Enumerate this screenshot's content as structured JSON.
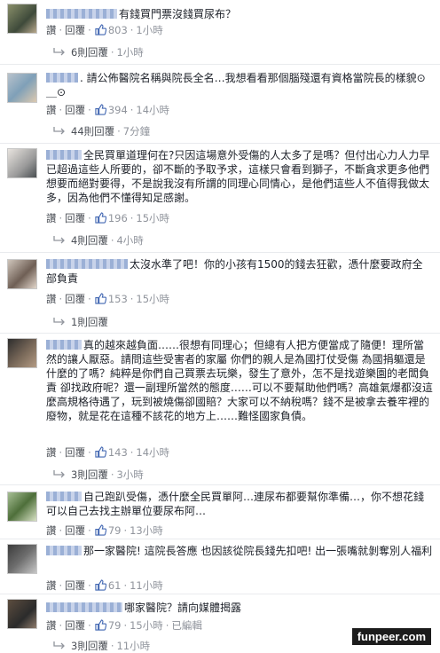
{
  "ui": {
    "like": "讚",
    "reply": "回覆",
    "dot": "·",
    "edited": "已編輯"
  },
  "comments": [
    {
      "text": "有錢買門票沒錢買尿布？",
      "likes": "803",
      "time": "1小時",
      "replies": "6則回覆",
      "replies_time": "1小時"
    },
    {
      "text": ". 請公佈醫院名稱與院長全名…我想看看那個腦殘還有資格當院長的樣貌⊙＿⊙",
      "likes": "394",
      "time": "14小時",
      "replies": "44則回覆",
      "replies_time": "7分鐘"
    },
    {
      "text": "全民買單道理何在?只因這場意外受傷的人太多了是嗎？但付出心力人力早已超過這些人所要的，卻不斷的予取予求，這樣只會看到獅子，不斷貪求更多他們想要而絕對要得，不是說我沒有所謂的同理心同情心，是他們這些人不值得我做太多，因為他們不懂得知足感謝。",
      "likes": "196",
      "time": "15小時",
      "replies": "4則回覆",
      "replies_time": "4小時"
    },
    {
      "text": "太沒水準了吧！你的小孩有1500的錢去狂歡，憑什麼要政府全部負責",
      "likes": "153",
      "time": "15小時",
      "replies": "1則回覆",
      "replies_time": ""
    },
    {
      "text": "真的越來越負面……很想有同理心；但總有人把方便當成了隨便！理所當然的讓人厭惡。請問這些受害者的家屬 你們的親人是為國打仗受傷 為國捐軀還是什麼的了嗎？純粹是你們自己買票去玩樂，發生了意外，怎不是找遊樂園的老闆負責 卻找政府呢？還一副理所當然的態度……可以不要幫助他們嗎？高雄氣爆都沒這麼高規格待遇了，玩到被燒傷卻國賠？大家可以不納稅嗎？錢不是被拿去養牢裡的廢物，就是花在這種不該花的地方上……難怪國家負債。",
      "likes": "143",
      "time": "14小時",
      "replies": "3則回覆",
      "replies_time": "3小時"
    },
    {
      "text": "自己跑趴受傷，憑什麼全民買單阿…連尿布都要幫你準備…，你不想花錢可以自己去找主辦單位要尿布阿…",
      "likes": "79",
      "time": "13小時",
      "replies": "",
      "replies_time": ""
    },
    {
      "text": "那一家醫院! 這院長答應 也因該從院長錢先扣吧! 出一張嘴就剝奪別人福利",
      "likes": "61",
      "time": "11小時",
      "replies": "",
      "replies_time": ""
    },
    {
      "text": "哪家醫院？請向媒體揭露",
      "likes": "79",
      "time": "15小時",
      "replies": "3則回覆",
      "replies_time": "11小時"
    }
  ],
  "watermark": "funpeer.com",
  "colors": {
    "link": "#4b4f56",
    "meta": "#90949c",
    "like_blue": "#4267b2",
    "name_blur": "#9bb0d6"
  }
}
